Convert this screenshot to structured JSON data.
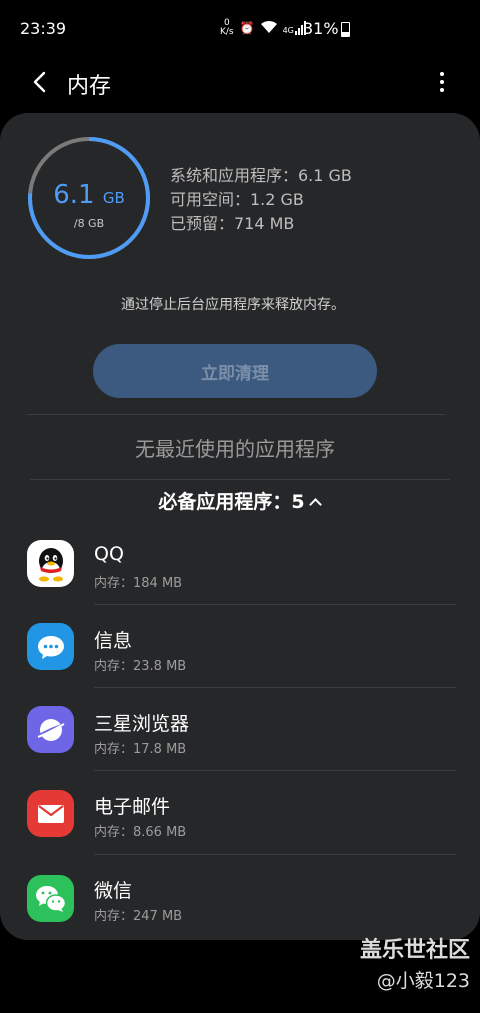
{
  "status_bar": {
    "time": "23:39",
    "network_speed": "0 K/s",
    "signal": "4G",
    "battery": "31%"
  },
  "header": {
    "title": "内存"
  },
  "memory": {
    "used_value": "6.1",
    "used_unit": "GB",
    "total": "/8 GB",
    "used_fraction": 0.7625,
    "system_apps": "系统和应用程序：6.1 GB",
    "available": "可用空间：1.2 GB",
    "reserved": "已预留：714 MB",
    "hint": "通过停止后台应用程序来释放内存。",
    "clean_button": "立即清理"
  },
  "recent": {
    "empty_text": "无最近使用的应用程序"
  },
  "essential": {
    "header": "必备应用程序：5",
    "apps": [
      {
        "name": "QQ",
        "memory": "内存：184 MB",
        "icon": "qq-icon"
      },
      {
        "name": "信息",
        "memory": "内存：23.8 MB",
        "icon": "messages-icon"
      },
      {
        "name": "三星浏览器",
        "memory": "内存：17.8 MB",
        "icon": "samsung-browser-icon"
      },
      {
        "name": "电子邮件",
        "memory": "内存：8.66 MB",
        "icon": "email-icon"
      },
      {
        "name": "微信",
        "memory": "内存：247 MB",
        "icon": "wechat-icon"
      }
    ]
  },
  "watermark": {
    "brand": "盖乐世社区",
    "user": "@小毅123"
  },
  "colors": {
    "accent": "#4e9cf6",
    "card": "#262729",
    "button": "#3c5a80"
  }
}
